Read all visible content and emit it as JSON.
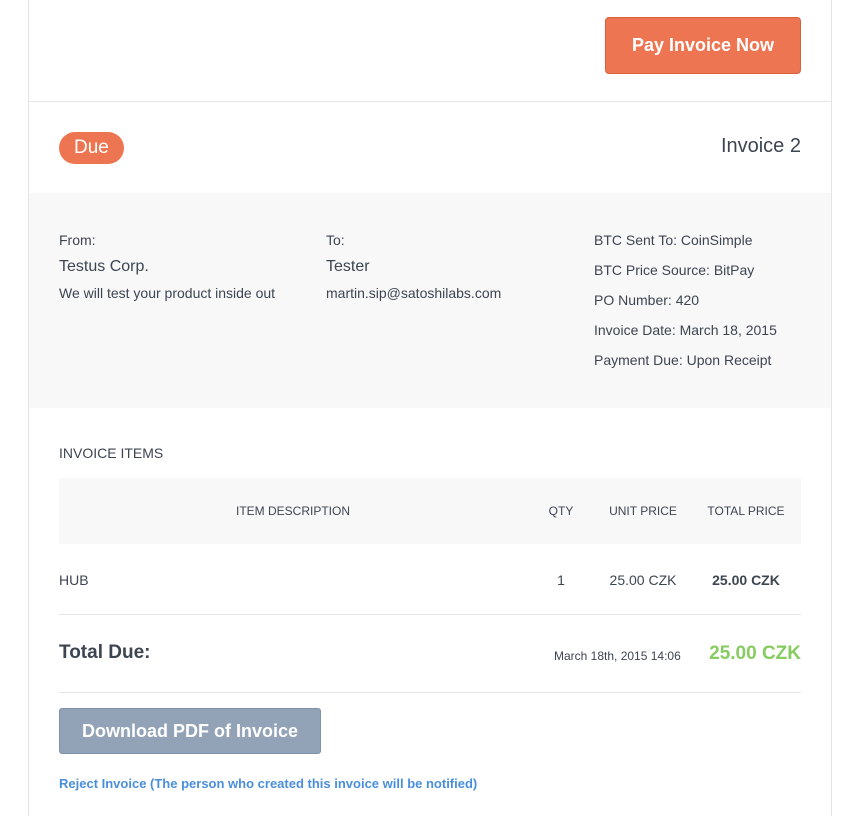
{
  "header": {
    "pay_button_label": "Pay Invoice Now"
  },
  "status": {
    "badge": "Due",
    "invoice_number": "Invoice 2",
    "badge_color": "#ee7552"
  },
  "from": {
    "label": "From:",
    "name": "Testus Corp.",
    "description": "We will test your product inside out"
  },
  "to": {
    "label": "To:",
    "name": "Tester",
    "email": "martin.sip@satoshilabs.com"
  },
  "meta": {
    "btc_sent_to": "BTC Sent To: CoinSimple",
    "btc_price_source": "BTC Price Source: BitPay",
    "po_number": "PO Number: 420",
    "invoice_date": "Invoice Date: March 18, 2015",
    "payment_due": "Payment Due: Upon Receipt"
  },
  "items": {
    "title": "INVOICE ITEMS",
    "columns": {
      "description": "ITEM DESCRIPTION",
      "qty": "QTY",
      "unit_price": "UNIT PRICE",
      "total_price": "TOTAL PRICE"
    },
    "rows": [
      {
        "description": "HUB",
        "qty": "1",
        "unit_price": "25.00 CZK",
        "total_price": "25.00 CZK"
      }
    ]
  },
  "total": {
    "label": "Total Due:",
    "date": "March 18th, 2015 14:06",
    "amount": "25.00 CZK",
    "amount_color": "#86cc61"
  },
  "actions": {
    "download_pdf_label": "Download PDF of Invoice",
    "reject_label": "Reject Invoice (The person who created this invoice will be notified)"
  }
}
